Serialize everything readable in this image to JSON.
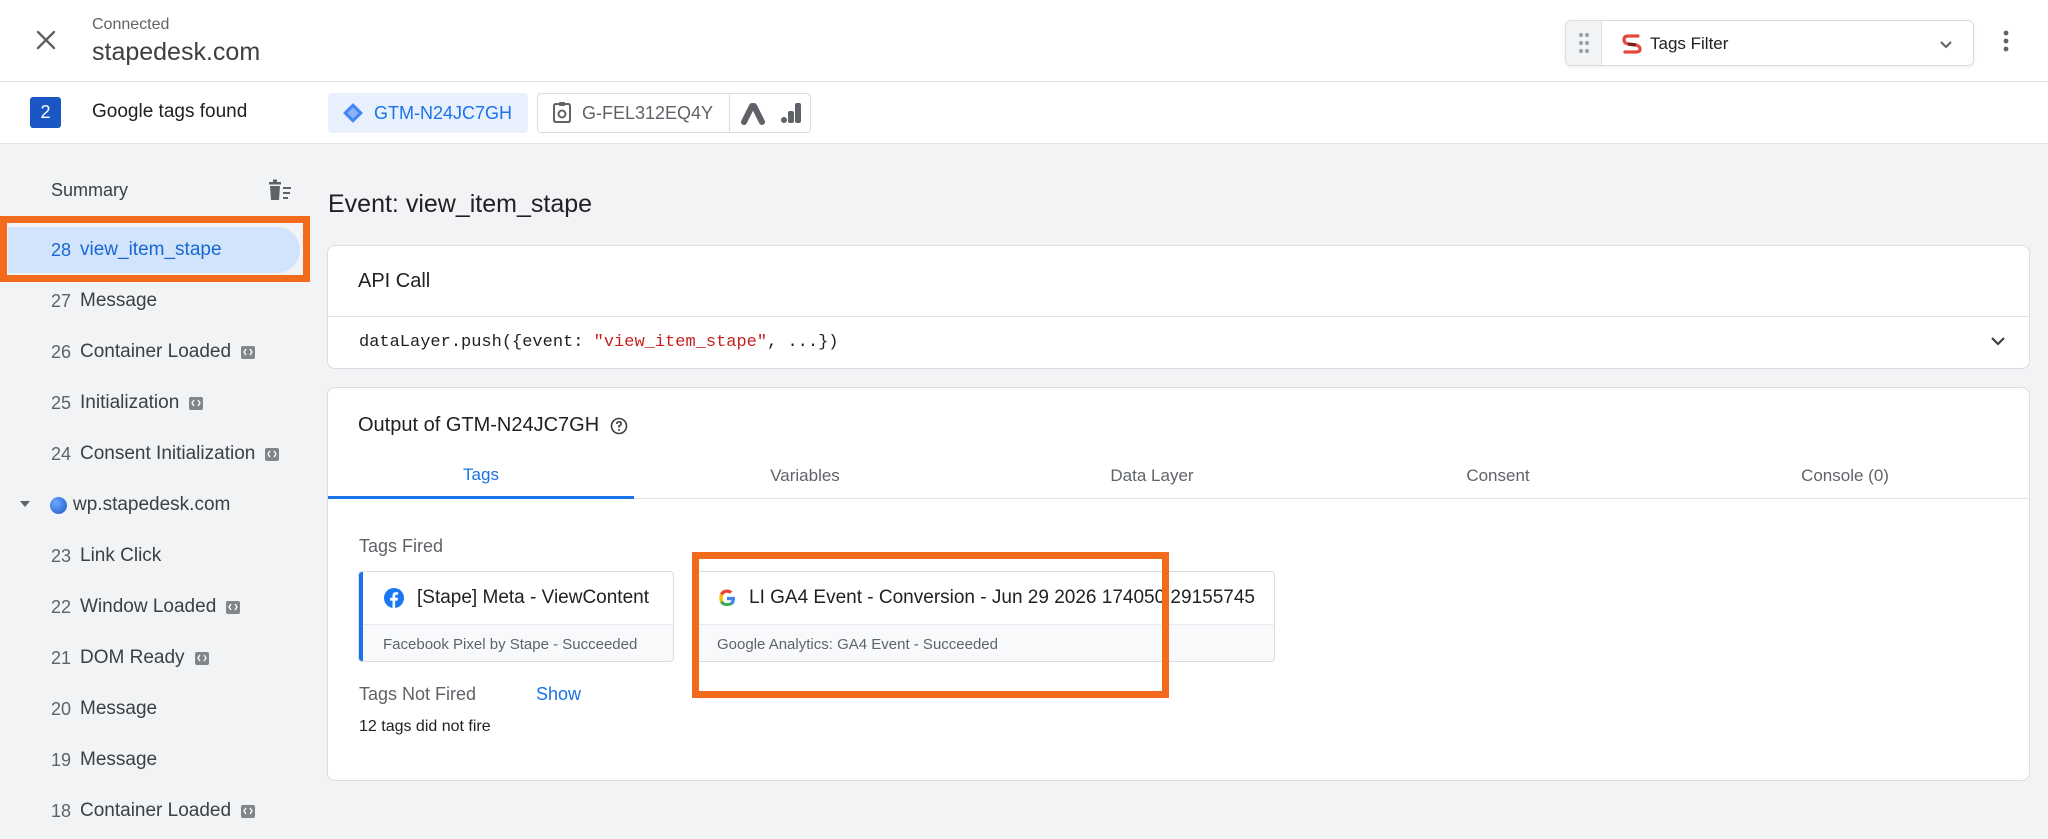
{
  "header": {
    "connection_status": "Connected",
    "domain": "stapedesk.com",
    "filter_label": "Tags Filter"
  },
  "tagbar": {
    "count": "2",
    "found_label": "Google tags found",
    "containers": [
      {
        "id": "GTM-N24JC7GH",
        "selected": true
      },
      {
        "id": "G-FEL312EQ4Y",
        "selected": false
      }
    ]
  },
  "sidebar": {
    "summary_label": "Summary",
    "items_top": [
      {
        "num": "28",
        "name": "view_item_stape",
        "active": true,
        "code": false
      },
      {
        "num": "27",
        "name": "Message",
        "active": false,
        "code": false
      },
      {
        "num": "26",
        "name": "Container Loaded",
        "active": false,
        "code": true
      },
      {
        "num": "25",
        "name": "Initialization",
        "active": false,
        "code": true
      },
      {
        "num": "24",
        "name": "Consent Initialization",
        "active": false,
        "code": true
      }
    ],
    "page_group": "wp.stapedesk.com",
    "items_bottom": [
      {
        "num": "23",
        "name": "Link Click",
        "code": false
      },
      {
        "num": "22",
        "name": "Window Loaded",
        "code": true
      },
      {
        "num": "21",
        "name": "DOM Ready",
        "code": true
      },
      {
        "num": "20",
        "name": "Message",
        "code": false
      },
      {
        "num": "19",
        "name": "Message",
        "code": false
      },
      {
        "num": "18",
        "name": "Container Loaded",
        "code": true
      }
    ]
  },
  "main": {
    "event_title": "Event: view_item_stape",
    "api_card": {
      "title": "API Call",
      "code_prefix": "dataLayer.push({event: ",
      "code_string": "\"view_item_stape\"",
      "code_suffix": ", ...})"
    },
    "output": {
      "title": "Output of GTM-N24JC7GH",
      "tabs": [
        "Tags",
        "Variables",
        "Data Layer",
        "Consent",
        "Console (0)"
      ],
      "active_tab": "Tags",
      "fired_label": "Tags Fired",
      "fired_tags": [
        {
          "name": "[Stape] Meta - ViewContent",
          "detail": "Facebook Pixel by Stape - Succeeded",
          "icon": "facebook-icon",
          "accent": "#1a73e8"
        },
        {
          "name": "LI GA4 Event - Conversion - Jun 29 2026 174050 29155745",
          "detail": "Google Analytics: GA4 Event - Succeeded",
          "icon": "google-icon",
          "accent": "#f9ab00"
        }
      ],
      "not_fired_label": "Tags Not Fired",
      "show_label": "Show",
      "not_fired_count": "12 tags did not fire"
    }
  },
  "colors": {
    "accent_blue": "#1a73e8",
    "highlight_orange": "#f26a1b",
    "badge_blue": "#1a56c4"
  }
}
